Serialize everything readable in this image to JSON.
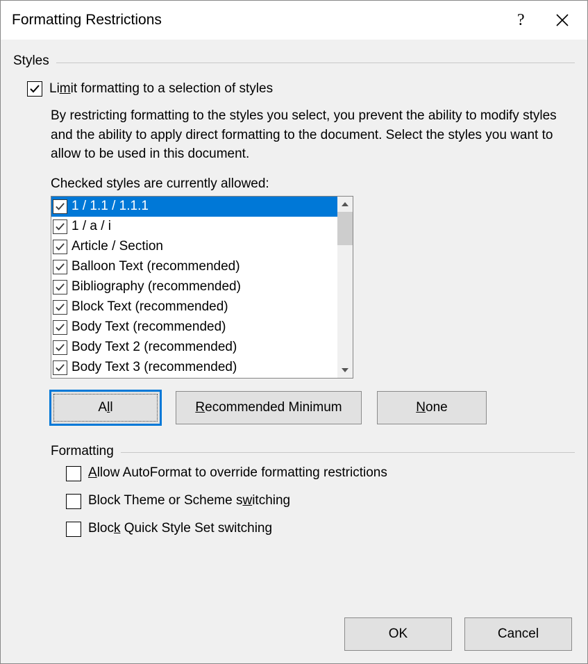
{
  "title": "Formatting Restrictions",
  "section_styles": {
    "heading": "Styles",
    "limit_text_pre": "Li",
    "limit_text_u": "m",
    "limit_text_post": "it formatting to a selection of styles",
    "limit_checked": true,
    "description": "By restricting formatting to the styles you select, you prevent the ability to modify styles and the ability to apply direct formatting to the document. Select the styles you want to allow to be used in this document.",
    "allowed_label": "Checked styles are currently allowed:",
    "items": [
      {
        "label": "1 / 1.1 / 1.1.1",
        "checked": true,
        "selected": true
      },
      {
        "label": "1 / a / i",
        "checked": true,
        "selected": false
      },
      {
        "label": "Article / Section",
        "checked": true,
        "selected": false
      },
      {
        "label": "Balloon Text (recommended)",
        "checked": true,
        "selected": false
      },
      {
        "label": "Bibliography (recommended)",
        "checked": true,
        "selected": false
      },
      {
        "label": "Block Text (recommended)",
        "checked": true,
        "selected": false
      },
      {
        "label": "Body Text (recommended)",
        "checked": true,
        "selected": false
      },
      {
        "label": "Body Text 2 (recommended)",
        "checked": true,
        "selected": false
      },
      {
        "label": "Body Text 3 (recommended)",
        "checked": true,
        "selected": false
      }
    ],
    "buttons": {
      "all_pre": "A",
      "all_u": "l",
      "all_post": "l",
      "rec_u": "R",
      "rec_post": "ecommended Minimum",
      "none_u": "N",
      "none_post": "one"
    }
  },
  "section_formatting": {
    "heading": "Formatting",
    "opt1_u": "A",
    "opt1_post": "llow AutoFormat to override formatting restrictions",
    "opt2_pre": "Block Theme or Scheme s",
    "opt2_u": "w",
    "opt2_post": "itching",
    "opt3_pre": "Bloc",
    "opt3_u": "k",
    "opt3_post": " Quick Style Set switching"
  },
  "footer": {
    "ok": "OK",
    "cancel": "Cancel"
  }
}
